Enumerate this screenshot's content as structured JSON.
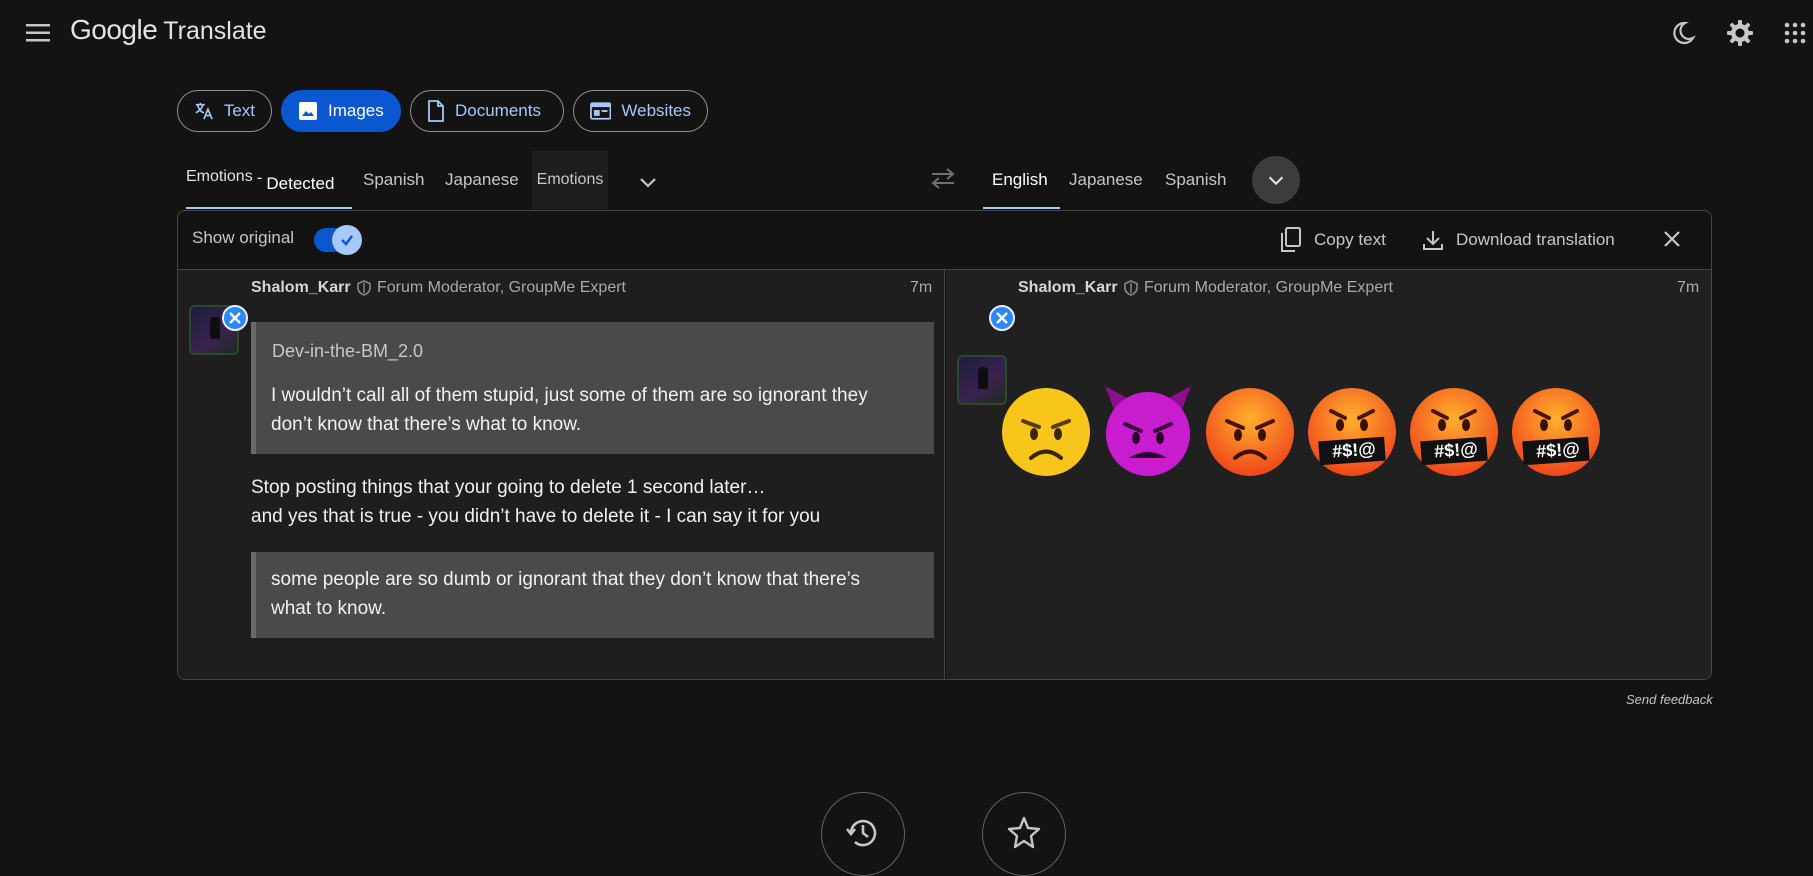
{
  "header": {
    "logo_google": "Google",
    "logo_product": "Translate"
  },
  "modes": [
    {
      "label": "Text",
      "icon": "translate-icon"
    },
    {
      "label": "Images",
      "icon": "image-icon",
      "active": true
    },
    {
      "label": "Documents",
      "icon": "document-icon"
    },
    {
      "label": "Websites",
      "icon": "website-icon"
    }
  ],
  "source_langs": {
    "detected_prefix": "Emotions",
    "detected_label": "Detected",
    "items": [
      "Spanish",
      "Japanese",
      "Emotions"
    ]
  },
  "target_langs": {
    "items": [
      "English",
      "Japanese",
      "Spanish"
    ],
    "active": "English"
  },
  "toolbar": {
    "show_original": "Show original",
    "copy_text": "Copy text",
    "download": "Download translation"
  },
  "post": {
    "username": "Shalom_Karr",
    "role": "Forum Moderator, GroupMe Expert",
    "time": "7m",
    "quote1": {
      "author": "Dev-in-the-BM_2.0",
      "lines": [
        "I wouldn’t call all of them stupid, just some of them are so ignorant they",
        "don’t know that there’s what to know."
      ]
    },
    "body": [
      "Stop posting things that your going to delete 1 second later…",
      "and yes that is true - you didn’t have to delete it - I can say it for you"
    ],
    "quote2": {
      "lines": [
        "some people are so dumb or ignorant that they don’t know that there’s",
        "what to know."
      ]
    }
  },
  "translation": {
    "username": "Shalom_Karr",
    "role": "Forum Moderator, GroupMe Expert",
    "time": "7m",
    "emojis": [
      "angry-face",
      "angry-face-with-horns",
      "pouting-face",
      "face-with-symbols-on-mouth",
      "face-with-symbols-on-mouth",
      "face-with-symbols-on-mouth"
    ],
    "symbols_text": "#$!@"
  },
  "footer": {
    "send_feedback": "Send feedback"
  },
  "colors": {
    "accent": "#a8c7fa",
    "active_chip": "#0b57d0",
    "background": "#131313"
  }
}
